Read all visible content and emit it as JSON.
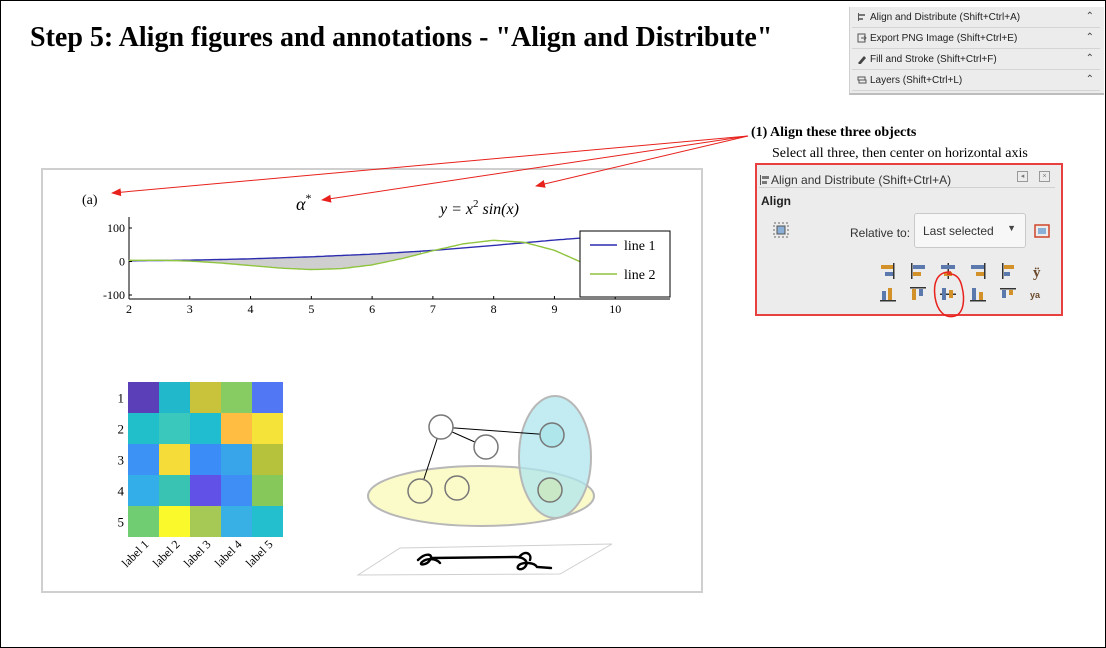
{
  "title": "Step 5: Align figures and annotations - \"Align and Distribute\"",
  "inkscape_panel": {
    "items": [
      {
        "label": "Align and Distribute (Shift+Ctrl+A)",
        "icon": "align-distribute-icon"
      },
      {
        "label": "Export PNG Image (Shift+Ctrl+E)",
        "icon": "export-png-icon"
      },
      {
        "label": "Fill and Stroke (Shift+Ctrl+F)",
        "icon": "fill-stroke-icon"
      },
      {
        "label": "Layers (Shift+Ctrl+L)",
        "icon": "layers-icon"
      }
    ]
  },
  "annotation": {
    "heading": "(1) Align these three objects",
    "subtext": "Select all three, then center on horizontal axis",
    "arrow_color": "#e8211c"
  },
  "align_panel": {
    "title": "Align and Distribute (Shift+Ctrl+A)",
    "section": "Align",
    "relative_label": "Relative to:",
    "relative_value": "Last selected",
    "border_color": "#e8403f"
  },
  "figure": {
    "panel_label": "(a)",
    "alpha_label": "α",
    "alpha_sup": "*",
    "formula_prefix": "y = x",
    "formula_sup": "2",
    "formula_suffix": " sin(x)",
    "heatmap_rows": [
      "1",
      "2",
      "3",
      "4",
      "5"
    ],
    "heatmap_cols": [
      "label 1",
      "label 2",
      "label 3",
      "label 4",
      "label 5"
    ],
    "heatmap_colors": [
      [
        "#5b3fb8",
        "#22b8cc",
        "#c8c33a",
        "#86cc62",
        "#5277f5"
      ],
      [
        "#20bfc9",
        "#3ac8bd",
        "#20bdd0",
        "#ffbe42",
        "#f5e33a"
      ],
      [
        "#3d93f5",
        "#f5dc38",
        "#3b8cf6",
        "#38a4ea",
        "#b6c23c"
      ],
      [
        "#34aee8",
        "#38c3b3",
        "#6251e6",
        "#3e8ef5",
        "#86c85a"
      ],
      [
        "#70cd72",
        "#f9f92b",
        "#a6c854",
        "#38b0e6",
        "#23bfce"
      ]
    ]
  },
  "chart_data": {
    "type": "line",
    "xlim": [
      2,
      11
    ],
    "ylim": [
      -100,
      100
    ],
    "x_ticks": [
      "2",
      "3",
      "4",
      "5",
      "6",
      "7",
      "8",
      "9",
      "10"
    ],
    "y_ticks": [
      "100",
      "0",
      "-100"
    ],
    "series": [
      {
        "name": "line 1",
        "color": "#2c2cb0",
        "x": [
          2,
          3,
          4,
          5,
          6,
          7,
          8,
          9,
          10
        ],
        "y": [
          2,
          4,
          8,
          14,
          22,
          33,
          48,
          64,
          78
        ]
      },
      {
        "name": "line 2",
        "color": "#8fc43e",
        "x": [
          2,
          2.5,
          3,
          3.5,
          4,
          4.5,
          5,
          5.5,
          6,
          6.5,
          7,
          7.5,
          8,
          8.5,
          9,
          9.5,
          10
        ],
        "y": [
          3.6,
          3.7,
          1.3,
          -4.3,
          -12.1,
          -19.8,
          -24.0,
          -21.2,
          -10.1,
          9.1,
          32.2,
          52.8,
          63.3,
          57.2,
          33.4,
          -6.8,
          -54.4
        ]
      }
    ],
    "shaded_between": "line 1 and line 2 (x 2–7)",
    "grid": false,
    "legend": "top-right"
  }
}
